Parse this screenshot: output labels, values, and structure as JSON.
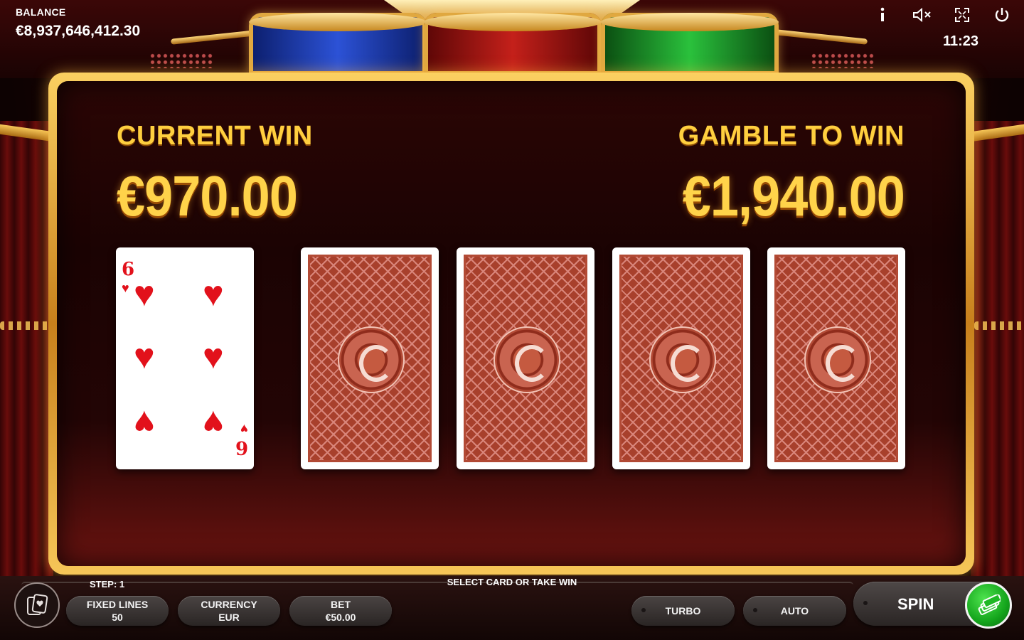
{
  "hud": {
    "balance_label": "BALANCE",
    "balance_value": "€8,937,646,412.30",
    "clock": "11:23",
    "icons": [
      "info-icon",
      "mute-icon",
      "fullscreen-icon",
      "power-icon"
    ]
  },
  "gamble": {
    "current_win_label": "CURRENT WIN",
    "current_win_value": "€970.00",
    "gamble_to_win_label": "GAMBLE TO WIN",
    "gamble_to_win_value": "€1,940.00",
    "dealer_card": {
      "rank": "6",
      "suit": "♥",
      "suit_name": "hearts"
    },
    "hidden_cards": 4
  },
  "bottom": {
    "step_label": "STEP: 1",
    "status_message": "SELECT CARD OR TAKE WIN",
    "fixed_lines_label": "FIXED LINES",
    "fixed_lines_value": "50",
    "currency_label": "CURRENCY",
    "currency_value": "EUR",
    "bet_label": "BET",
    "bet_value": "€50.00",
    "turbo_label": "TURBO",
    "auto_label": "AUTO",
    "spin_label": "SPIN"
  },
  "colors": {
    "gold_text": "#ffcf3f",
    "panel_frame": "#f2b640",
    "spin_button": "#1fb825",
    "card_red": "#e2111b"
  }
}
